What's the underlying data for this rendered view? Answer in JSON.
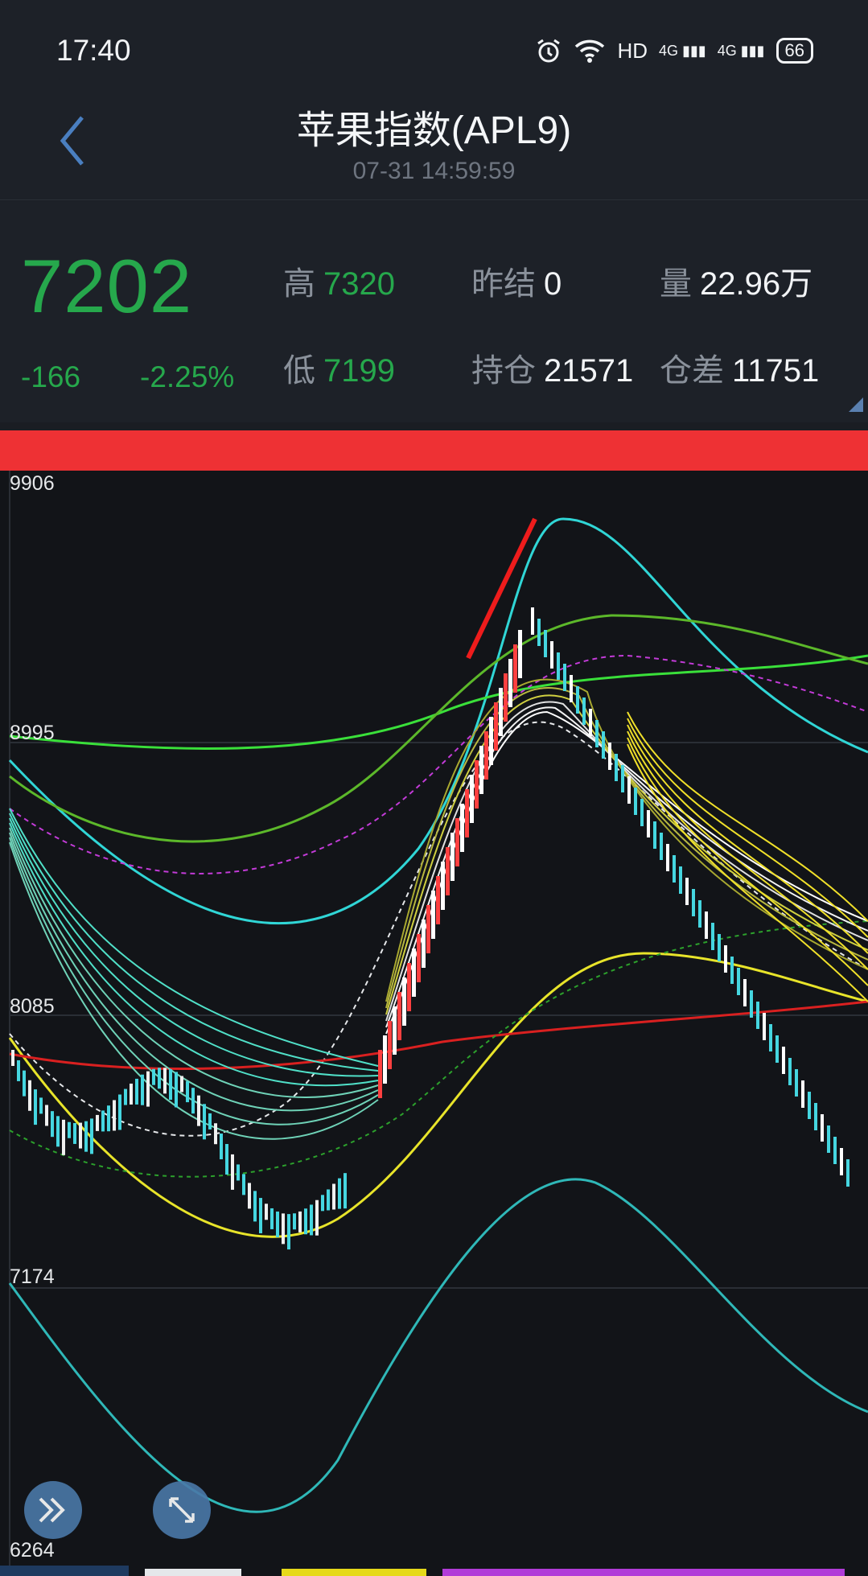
{
  "status": {
    "time": "17:40",
    "net_label": "HD",
    "sig1": "4G",
    "sig2": "4G",
    "battery": "66"
  },
  "header": {
    "title": "苹果指数(APL9)",
    "timestamp": "07-31 14:59:59"
  },
  "quote": {
    "price": "7202",
    "change": "-166",
    "change_pct": "-2.25%",
    "high_label": "高",
    "high": "7320",
    "low_label": "低",
    "low": "7199",
    "prev_settle_label": "昨结",
    "prev_settle": "0",
    "volume_label": "量",
    "volume": "22.96万",
    "open_interest_label": "持仓",
    "open_interest": "21571",
    "oi_change_label": "仓差",
    "oi_change": "11751"
  },
  "chart": {
    "y_labels": [
      "9906",
      "8995",
      "8085",
      "7174",
      "6264"
    ]
  },
  "colors": {
    "up_green": "#26a84c",
    "banner_red": "#ee3134",
    "accent_blue": "#4a78a8"
  },
  "icons": [
    "back-icon",
    "search-icon",
    "alarm-icon",
    "wifi-icon",
    "signal-icon",
    "battery-icon",
    "fast-forward-icon",
    "fullscreen-icon"
  ]
}
